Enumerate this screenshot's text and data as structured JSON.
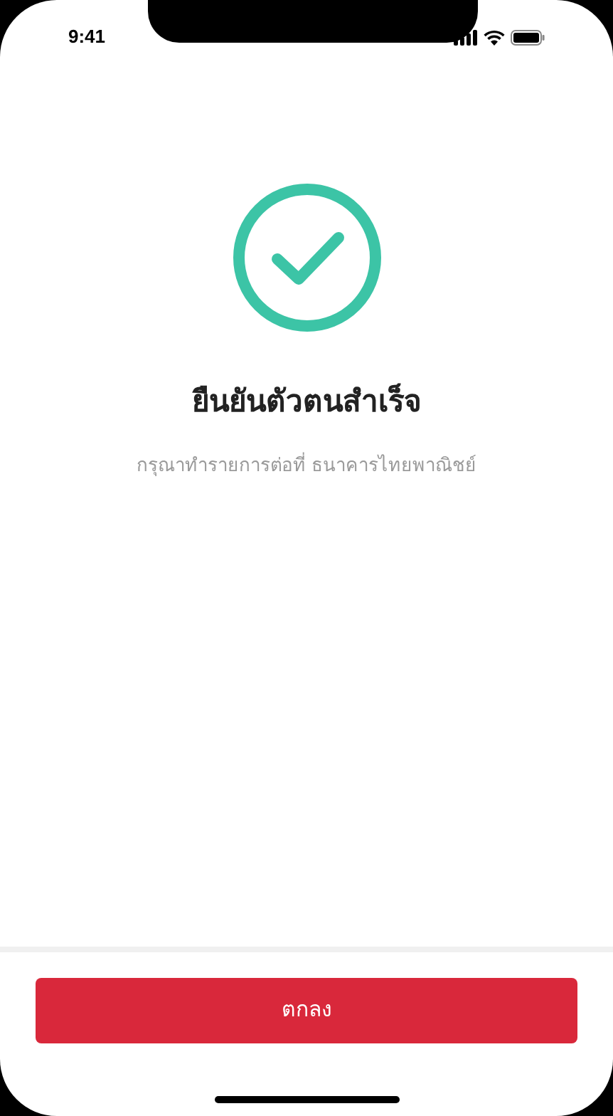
{
  "status_bar": {
    "time": "9:41"
  },
  "title": "ยืนยันตัวตนสำเร็จ",
  "subtitle": "กรุณาทำรายการต่อที่ ธนาคารไทยพาณิชย์",
  "button": {
    "label": "ตกลง"
  }
}
